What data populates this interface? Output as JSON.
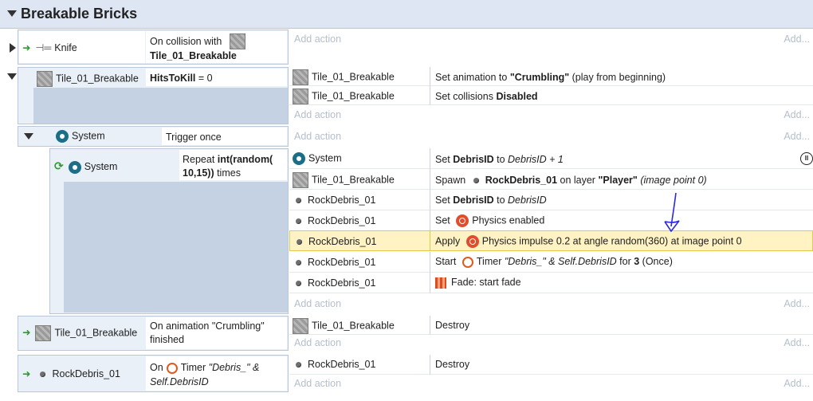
{
  "group": {
    "title": "Breakable Bricks"
  },
  "add_action_label": "Add action",
  "add_more_label": "Add...",
  "events": {
    "e1": {
      "object": "Knife",
      "cond_text": "On collision with",
      "cond_target": "Tile_01_Breakable"
    },
    "e2": {
      "object": "Tile_01_Breakable",
      "cond_var": "HitsToKill",
      "cond_rest": " = 0",
      "actions": [
        {
          "object": "Tile_01_Breakable",
          "pre": "Set animation to ",
          "bold": "\"Crumbling\"",
          "post": " (play from beginning)"
        },
        {
          "object": "Tile_01_Breakable",
          "pre": "Set collisions ",
          "bold": "Disabled",
          "post": ""
        }
      ]
    },
    "e3": {
      "object": "System",
      "cond": "Trigger once"
    },
    "e4": {
      "object": "System",
      "cond_pre": "Repeat ",
      "cond_bold": "int(random(",
      "cond_bold2": "10,15))",
      "cond_post": " times",
      "a1": {
        "object": "System",
        "pre": "Set ",
        "bold": "DebrisID",
        "mid": " to ",
        "ital": "DebrisID + 1"
      },
      "a2": {
        "object": "Tile_01_Breakable",
        "pre": "Spawn ",
        "bold": "RockDebris_01",
        "mid": " on layer ",
        "bold2": "\"Player\"",
        "ital": " (image point 0)"
      },
      "a3": {
        "object": "RockDebris_01",
        "pre": "Set ",
        "bold": "DebrisID",
        "mid": " to ",
        "ital": "DebrisID"
      },
      "a4": {
        "object": "RockDebris_01",
        "pre": "Set ",
        "text": "Physics enabled"
      },
      "a5": {
        "object": "RockDebris_01",
        "pre": "Apply ",
        "text": "Physics impulse 0.2 at angle random(360) at image point 0"
      },
      "a6": {
        "object": "RockDebris_01",
        "pre": "Start ",
        "text": "Timer ",
        "ital": "\"Debris_\" & Self.DebrisID",
        "mid": " for ",
        "bold": "3",
        "post": " (Once)"
      },
      "a7": {
        "object": "RockDebris_01",
        "text": "Fade: start fade"
      }
    },
    "e5": {
      "object": "Tile_01_Breakable",
      "cond_line1": "On animation \"Crumbling\"",
      "cond_line2": "finished",
      "action_object": "Tile_01_Breakable",
      "action": "Destroy"
    },
    "e6": {
      "object": "RockDebris_01",
      "cond_pre": "On",
      "cond_text": "Timer ",
      "cond_ital": "\"Debris_\" &",
      "cond_ital2": "Self.DebrisID",
      "action_object": "RockDebris_01",
      "action": "Destroy"
    }
  }
}
